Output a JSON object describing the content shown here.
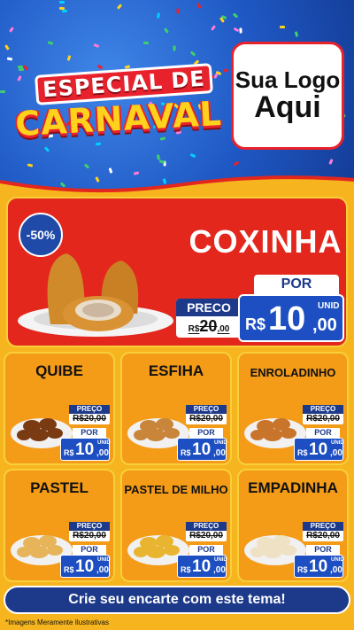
{
  "header": {
    "title_line1": "ESPECIAL DE",
    "title_line2": "CARNAVAL",
    "logo_line1": "Sua Logo",
    "logo_line2": "Aqui"
  },
  "hero": {
    "discount": "-50%",
    "name": "COXINHA",
    "old_label": "PRECO",
    "old_currency": "R$",
    "old_int": "20",
    "old_dec": ",00",
    "por_label": "POR",
    "unid": "UNID",
    "currency": "R$",
    "price_int": "10",
    "price_dec": ",00"
  },
  "products": [
    {
      "name": "QUIBE",
      "old_label": "PREÇO",
      "old": "R$20,00",
      "por": "POR",
      "unid": "UNID",
      "cur": "R$",
      "int": "10",
      "dec": ",00"
    },
    {
      "name": "ESFIHA",
      "old_label": "PREÇO",
      "old": "R$20,00",
      "por": "POR",
      "unid": "UNID",
      "cur": "R$",
      "int": "10",
      "dec": ",00"
    },
    {
      "name": "ENROLADINHO",
      "old_label": "PREÇO",
      "old": "R$20,00",
      "por": "POR",
      "unid": "UNID",
      "cur": "R$",
      "int": "10",
      "dec": ",00"
    },
    {
      "name": "PASTEL",
      "old_label": "PREÇO",
      "old": "R$20,00",
      "por": "POR",
      "unid": "UNID",
      "cur": "R$",
      "int": "10",
      "dec": ",00"
    },
    {
      "name": "PASTEL DE MILHO",
      "old_label": "PREÇO",
      "old": "R$20,00",
      "por": "POR",
      "unid": "UNID",
      "cur": "R$",
      "int": "10",
      "dec": ",00"
    },
    {
      "name": "EMPADINHA",
      "old_label": "PREÇO",
      "old": "R$20,00",
      "por": "POR",
      "unid": "UNID",
      "cur": "R$",
      "int": "10",
      "dec": ",00"
    }
  ],
  "cta": "Crie seu encarte com este tema!",
  "footnote": "*Imagens Meramente Ilustrativas",
  "colors": {
    "header_blue": "#1f58c4",
    "hero_red": "#e3271d",
    "card_orange": "#f49b18",
    "price_blue": "#1d4fc2",
    "navy": "#1d3a8a",
    "yellow": "#ffd21d"
  }
}
